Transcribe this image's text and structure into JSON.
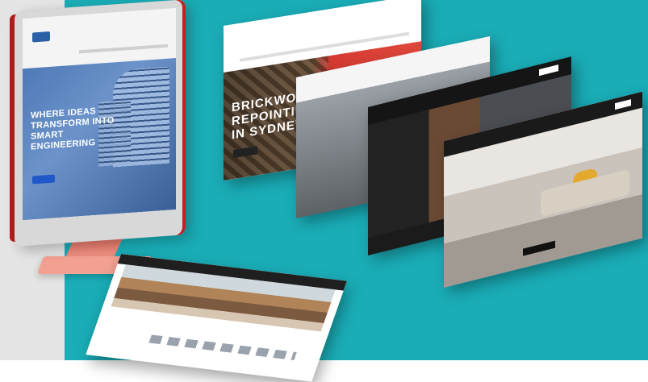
{
  "monitor": {
    "headline_lines": [
      "WHERE IDEAS",
      "TRANSFORM INTO",
      "SMART",
      "ENGINEERING"
    ]
  },
  "page_brick": {
    "title_lines": [
      "BRICKWORK",
      "REPOINTING",
      "IN SYDNEY"
    ]
  },
  "colors": {
    "background": "#1aadb7",
    "side_panel": "#e4e5e4",
    "accent_red": "#c61f1f"
  }
}
